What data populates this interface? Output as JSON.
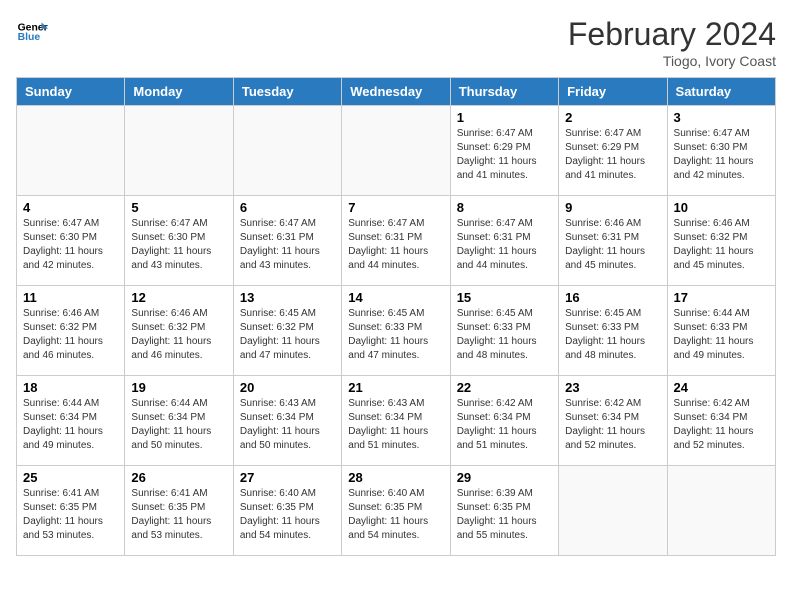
{
  "header": {
    "logo_line1": "General",
    "logo_line2": "Blue",
    "month_year": "February 2024",
    "location": "Tiogo, Ivory Coast"
  },
  "days_of_week": [
    "Sunday",
    "Monday",
    "Tuesday",
    "Wednesday",
    "Thursday",
    "Friday",
    "Saturday"
  ],
  "weeks": [
    [
      {
        "day": "",
        "empty": true
      },
      {
        "day": "",
        "empty": true
      },
      {
        "day": "",
        "empty": true
      },
      {
        "day": "",
        "empty": true
      },
      {
        "day": "1",
        "sunrise": "6:47 AM",
        "sunset": "6:29 PM",
        "daylight": "11 hours and 41 minutes."
      },
      {
        "day": "2",
        "sunrise": "6:47 AM",
        "sunset": "6:29 PM",
        "daylight": "11 hours and 41 minutes."
      },
      {
        "day": "3",
        "sunrise": "6:47 AM",
        "sunset": "6:30 PM",
        "daylight": "11 hours and 42 minutes."
      }
    ],
    [
      {
        "day": "4",
        "sunrise": "6:47 AM",
        "sunset": "6:30 PM",
        "daylight": "11 hours and 42 minutes."
      },
      {
        "day": "5",
        "sunrise": "6:47 AM",
        "sunset": "6:30 PM",
        "daylight": "11 hours and 43 minutes."
      },
      {
        "day": "6",
        "sunrise": "6:47 AM",
        "sunset": "6:31 PM",
        "daylight": "11 hours and 43 minutes."
      },
      {
        "day": "7",
        "sunrise": "6:47 AM",
        "sunset": "6:31 PM",
        "daylight": "11 hours and 44 minutes."
      },
      {
        "day": "8",
        "sunrise": "6:47 AM",
        "sunset": "6:31 PM",
        "daylight": "11 hours and 44 minutes."
      },
      {
        "day": "9",
        "sunrise": "6:46 AM",
        "sunset": "6:31 PM",
        "daylight": "11 hours and 45 minutes."
      },
      {
        "day": "10",
        "sunrise": "6:46 AM",
        "sunset": "6:32 PM",
        "daylight": "11 hours and 45 minutes."
      }
    ],
    [
      {
        "day": "11",
        "sunrise": "6:46 AM",
        "sunset": "6:32 PM",
        "daylight": "11 hours and 46 minutes."
      },
      {
        "day": "12",
        "sunrise": "6:46 AM",
        "sunset": "6:32 PM",
        "daylight": "11 hours and 46 minutes."
      },
      {
        "day": "13",
        "sunrise": "6:45 AM",
        "sunset": "6:32 PM",
        "daylight": "11 hours and 47 minutes."
      },
      {
        "day": "14",
        "sunrise": "6:45 AM",
        "sunset": "6:33 PM",
        "daylight": "11 hours and 47 minutes."
      },
      {
        "day": "15",
        "sunrise": "6:45 AM",
        "sunset": "6:33 PM",
        "daylight": "11 hours and 48 minutes."
      },
      {
        "day": "16",
        "sunrise": "6:45 AM",
        "sunset": "6:33 PM",
        "daylight": "11 hours and 48 minutes."
      },
      {
        "day": "17",
        "sunrise": "6:44 AM",
        "sunset": "6:33 PM",
        "daylight": "11 hours and 49 minutes."
      }
    ],
    [
      {
        "day": "18",
        "sunrise": "6:44 AM",
        "sunset": "6:34 PM",
        "daylight": "11 hours and 49 minutes."
      },
      {
        "day": "19",
        "sunrise": "6:44 AM",
        "sunset": "6:34 PM",
        "daylight": "11 hours and 50 minutes."
      },
      {
        "day": "20",
        "sunrise": "6:43 AM",
        "sunset": "6:34 PM",
        "daylight": "11 hours and 50 minutes."
      },
      {
        "day": "21",
        "sunrise": "6:43 AM",
        "sunset": "6:34 PM",
        "daylight": "11 hours and 51 minutes."
      },
      {
        "day": "22",
        "sunrise": "6:42 AM",
        "sunset": "6:34 PM",
        "daylight": "11 hours and 51 minutes."
      },
      {
        "day": "23",
        "sunrise": "6:42 AM",
        "sunset": "6:34 PM",
        "daylight": "11 hours and 52 minutes."
      },
      {
        "day": "24",
        "sunrise": "6:42 AM",
        "sunset": "6:34 PM",
        "daylight": "11 hours and 52 minutes."
      }
    ],
    [
      {
        "day": "25",
        "sunrise": "6:41 AM",
        "sunset": "6:35 PM",
        "daylight": "11 hours and 53 minutes."
      },
      {
        "day": "26",
        "sunrise": "6:41 AM",
        "sunset": "6:35 PM",
        "daylight": "11 hours and 53 minutes."
      },
      {
        "day": "27",
        "sunrise": "6:40 AM",
        "sunset": "6:35 PM",
        "daylight": "11 hours and 54 minutes."
      },
      {
        "day": "28",
        "sunrise": "6:40 AM",
        "sunset": "6:35 PM",
        "daylight": "11 hours and 54 minutes."
      },
      {
        "day": "29",
        "sunrise": "6:39 AM",
        "sunset": "6:35 PM",
        "daylight": "11 hours and 55 minutes."
      },
      {
        "day": "",
        "empty": true
      },
      {
        "day": "",
        "empty": true
      }
    ]
  ]
}
